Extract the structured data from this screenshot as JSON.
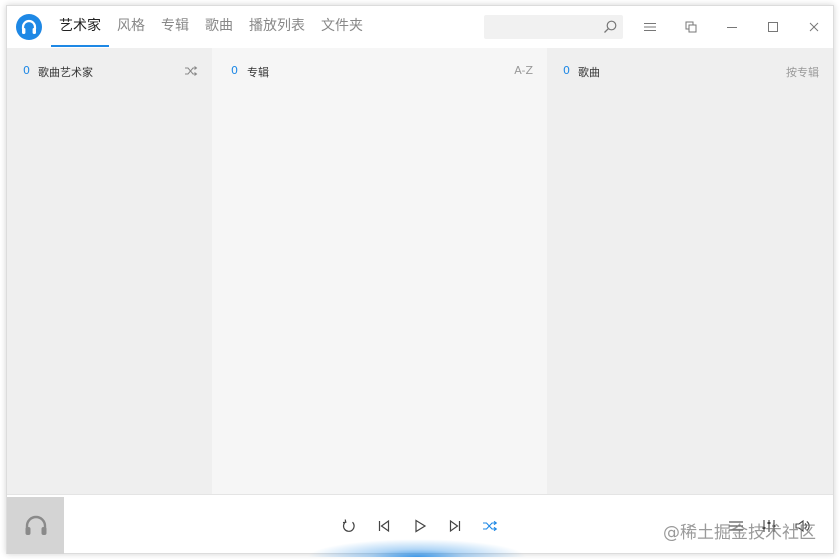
{
  "titlebar": {
    "tabs": [
      {
        "label": "艺术家",
        "active": true
      },
      {
        "label": "风格",
        "active": false
      },
      {
        "label": "专辑",
        "active": false
      },
      {
        "label": "歌曲",
        "active": false
      },
      {
        "label": "播放列表",
        "active": false
      },
      {
        "label": "文件夹",
        "active": false
      }
    ],
    "search": {
      "value": "",
      "placeholder": ""
    }
  },
  "panes": {
    "artists": {
      "count": "0",
      "title": "歌曲艺术家",
      "action_icon": "shuffle-icon"
    },
    "albums": {
      "count": "0",
      "title": "专辑",
      "sort_label": "A-Z"
    },
    "songs": {
      "count": "0",
      "title": "歌曲",
      "sort_label": "按专辑"
    }
  },
  "player": {
    "controls": [
      "repeat-icon",
      "previous-icon",
      "play-icon",
      "next-icon",
      "shuffle-icon"
    ],
    "right_controls": [
      "queue-icon",
      "equalizer-icon",
      "volume-icon"
    ]
  },
  "watermark": "@稀土掘金技术社区",
  "colors": {
    "accent": "#1e88e5",
    "pane_bg": "#efefef",
    "pane_mid_bg": "#f6f6f6"
  }
}
